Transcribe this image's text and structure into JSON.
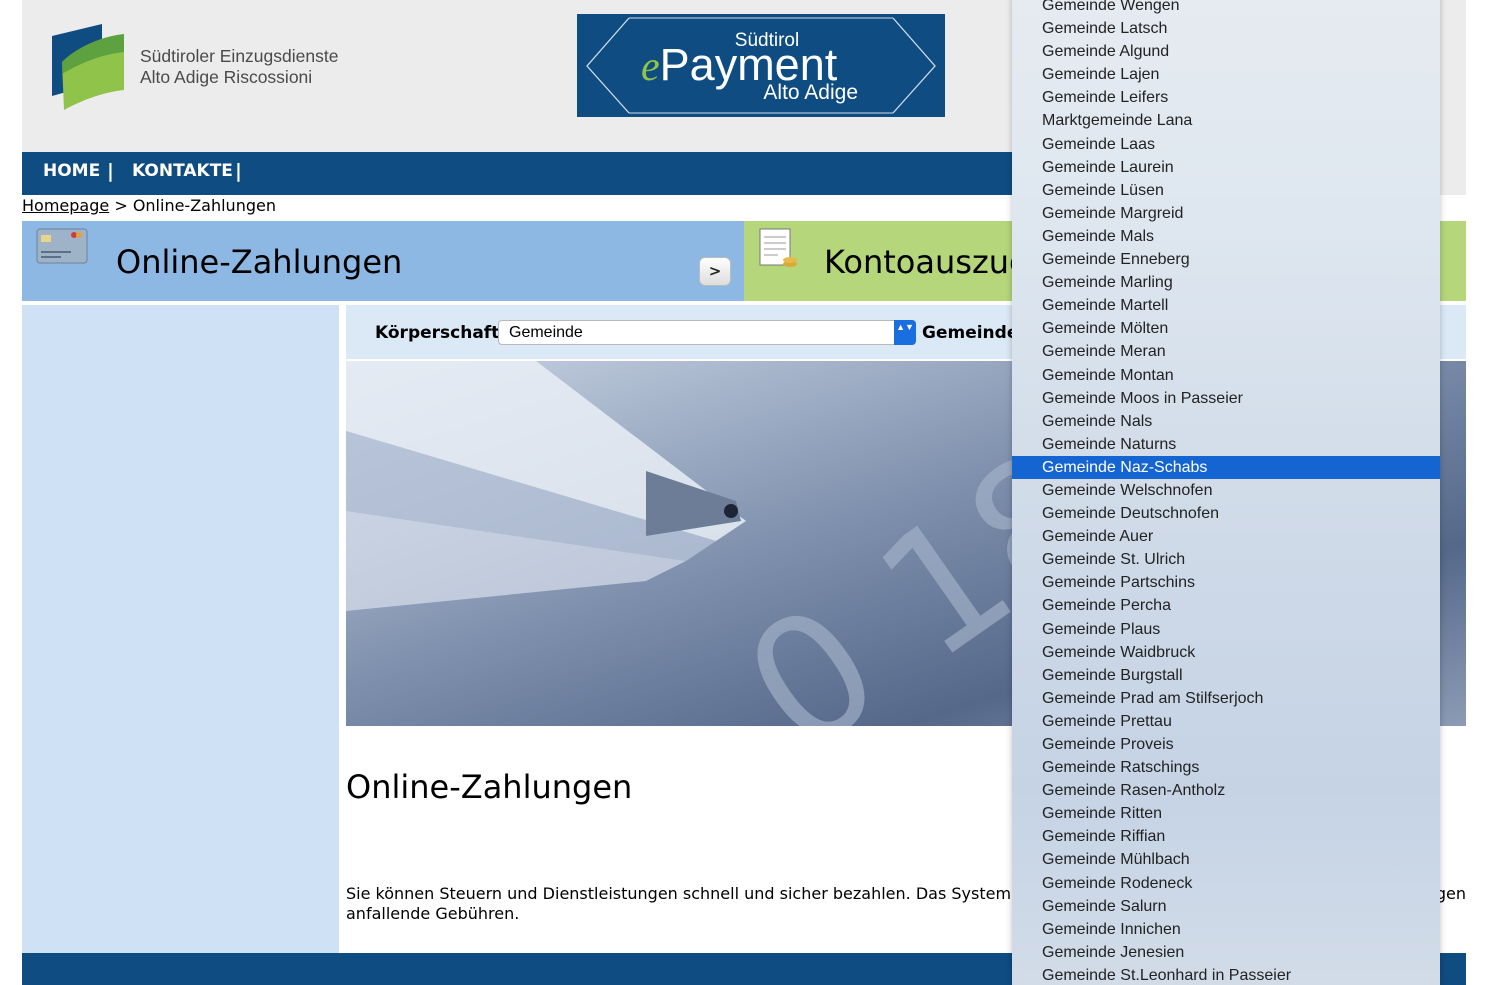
{
  "header": {
    "logo_line1": "Südtiroler Einzugsdienste",
    "logo_line2": "Alto Adige Riscossioni",
    "banner_top": "Südtirol",
    "banner_e": "e",
    "banner_main": "Payment",
    "banner_bottom": "Alto Adige"
  },
  "nav": {
    "items": [
      {
        "label": "HOME"
      },
      {
        "label": "KONTAKTE"
      }
    ],
    "separator": "|"
  },
  "breadcrumb": {
    "home": "Homepage",
    "separator": ">",
    "current": "Online-Zahlungen"
  },
  "tiles": [
    {
      "title": "Online-Zahlungen",
      "arrow": ">"
    },
    {
      "title": "Kontoauszug",
      "arrow": ">"
    }
  ],
  "selector": {
    "label1": "Körperschaft",
    "value1": "Gemeinde",
    "label2": "Gemeinde",
    "caret": "▲▼"
  },
  "content": {
    "heading": "Online-Zahlungen",
    "paragraph_line1": "Sie können Steuern und Dienstleistungen schnell und sicher bezahlen. Das System erre",
    "paragraph_line1_tail": "gen",
    "paragraph_line2": "anfallende Gebühren."
  },
  "dropdown": {
    "selected_index": 20,
    "options": [
      "Gemeinde Wengen",
      "Gemeinde Latsch",
      "Gemeinde Algund",
      "Gemeinde Lajen",
      "Gemeinde Leifers",
      "Marktgemeinde Lana",
      "Gemeinde Laas",
      "Gemeinde Laurein",
      "Gemeinde Lüsen",
      "Gemeinde Margreid",
      "Gemeinde Mals",
      "Gemeinde Enneberg",
      "Gemeinde Marling",
      "Gemeinde Martell",
      "Gemeinde Mölten",
      "Gemeinde Meran",
      "Gemeinde Montan",
      "Gemeinde Moos in Passeier",
      "Gemeinde Nals",
      "Gemeinde Naturns",
      "Gemeinde Naz-Schabs",
      "Gemeinde Welschnofen",
      "Gemeinde Deutschnofen",
      "Gemeinde Auer",
      "Gemeinde St. Ulrich",
      "Gemeinde Partschins",
      "Gemeinde Percha",
      "Gemeinde Plaus",
      "Gemeinde Waidbruck",
      "Gemeinde Burgstall",
      "Gemeinde Prad am Stilfserjoch",
      "Gemeinde Prettau",
      "Gemeinde Proveis",
      "Gemeinde Ratschings",
      "Gemeinde Rasen-Antholz",
      "Gemeinde Ritten",
      "Gemeinde Riffian",
      "Gemeinde Mühlbach",
      "Gemeinde Rodeneck",
      "Gemeinde Salurn",
      "Gemeinde Innichen",
      "Gemeinde Jenesien",
      "Gemeinde St.Leonhard in Passeier"
    ]
  },
  "colors": {
    "nav": "#0f4c81",
    "tile_blue": "#8db8e3",
    "tile_green": "#b5d67a",
    "selected": "#1464d2"
  }
}
